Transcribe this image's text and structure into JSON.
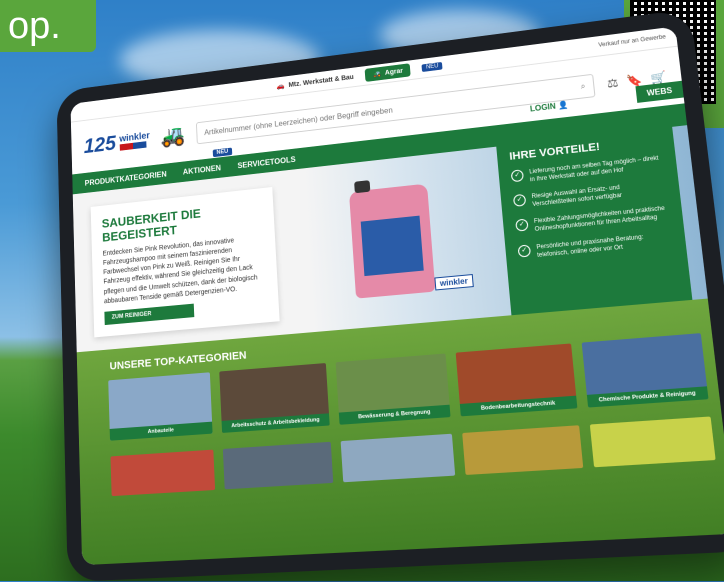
{
  "banner": {
    "text": "op."
  },
  "topbar": {
    "tab1": "Mtz. Werkstatt & Bau",
    "tab2": "Agrar",
    "new_badge": "NEU",
    "right_text": "Verkauf nur an Gewerbe"
  },
  "header": {
    "logo_number": "125",
    "brand": "winkler",
    "search_placeholder": "Artikelnummer (ohne Leerzeichen) oder Begriff eingeben",
    "login": "LOGIN",
    "website_button": "WEBS"
  },
  "nav": {
    "items": [
      "PRODUKTKATEGORIEN",
      "AKTIONEN",
      "SERVICETOOLS"
    ],
    "new_badge": "NEU"
  },
  "hero": {
    "title": "SAUBERKEIT DIE BEGEISTERT",
    "text": "Entdecken Sie Pink Revolution, das innovative Fahrzeugshampoo mit seinem faszinierenden Farbwechsel von Pink zu Weiß. Reinigen Sie Ihr Fahrzeug effektiv, während Sie gleichzeitig den Lack pflegen und die Umwelt schützen, dank der biologisch abbaubaren Tenside gemäß Detergenzien-VO.",
    "button": "ZUM REINIGER",
    "brand_tag": "winkler"
  },
  "advantages": {
    "title": "IHRE VORTEILE!",
    "items": [
      "Lieferung noch am selben Tag möglich – direkt in Ihre Werkstatt oder auf den Hof",
      "Riesige Auswahl an Ersatz- und Verschleißteilen sofort verfügbar",
      "Flexible Zahlungsmöglichkeiten und praktische Onlineshopfunktionen für Ihren Arbeitsalltag",
      "Persönliche und praxisnahe Beratung: telefonisch, online oder vor Ort"
    ]
  },
  "categories": {
    "title": "UNSERE TOP-KATEGORIEN",
    "items": [
      {
        "label": "Anbauteile",
        "color": "#8aa8c8"
      },
      {
        "label": "Arbeitsschutz & Arbeitsbekleidung",
        "color": "#5c4a3a"
      },
      {
        "label": "Bewässerung & Beregnung",
        "color": "#6b8f4a"
      },
      {
        "label": "Bodenbearbeitungstechnik",
        "color": "#a04a2a"
      },
      {
        "label": "Chemische Produkte & Reinigung",
        "color": "#4a6fa0"
      }
    ],
    "second_row_colors": [
      "#c14a3a",
      "#5a6a7a",
      "#8ea8c0",
      "#b89a3a",
      "#c8d24a"
    ]
  }
}
